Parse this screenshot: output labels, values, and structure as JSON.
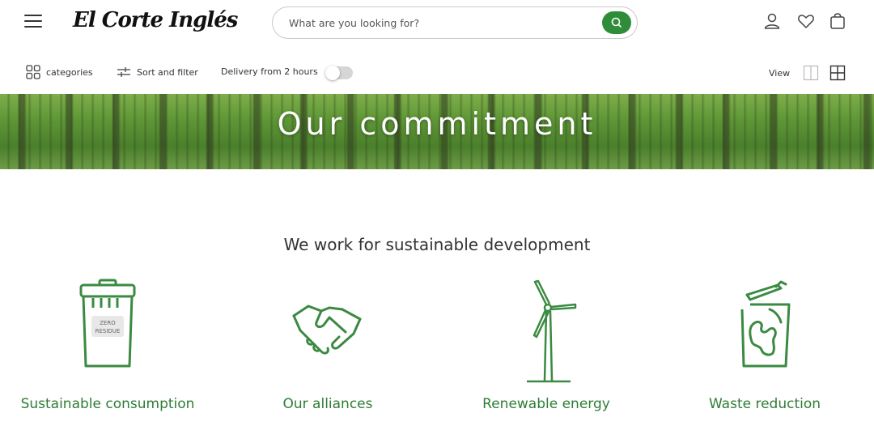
{
  "header": {
    "logo_text": "El Corte Inglés",
    "search_placeholder": "What are you looking for?"
  },
  "toolbar": {
    "categories_label": "categories",
    "sort_filter_label": "Sort and filter",
    "delivery_label": "Delivery from 2 hours",
    "view_label": "View"
  },
  "banner": {
    "title": "Our commitment"
  },
  "main": {
    "section_title": "We work for sustainable development",
    "features": [
      {
        "label": "Sustainable consumption",
        "bin_text_line1": "ZERO",
        "bin_text_line2": "RESIDUE"
      },
      {
        "label": "Our alliances"
      },
      {
        "label": "Renewable energy"
      },
      {
        "label": "Waste reduction"
      }
    ]
  },
  "colors": {
    "accent_green": "#2f8d3a",
    "label_green": "#2e7d36"
  }
}
